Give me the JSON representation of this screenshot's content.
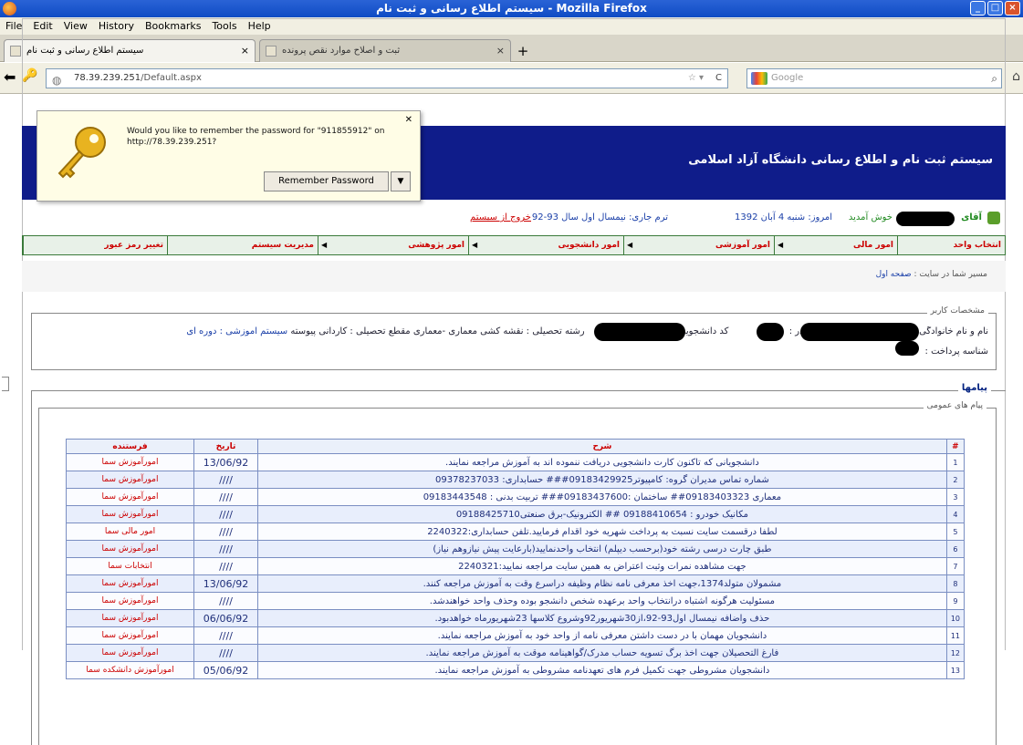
{
  "window": {
    "title": "سیستم اطلاع رسانی و ثبت نام - Mozilla Firefox"
  },
  "menu": [
    "File",
    "Edit",
    "View",
    "History",
    "Bookmarks",
    "Tools",
    "Help"
  ],
  "tabs": [
    {
      "label": "سیستم اطلاع رسانی و ثبت نام",
      "active": true
    },
    {
      "label": "ثبت و اصلاح موارد نقص پرونده",
      "active": false
    }
  ],
  "nav": {
    "url_host": "78.39.239.251",
    "url_path": "/Default.aspx",
    "search_placeholder": "Google"
  },
  "password_prompt": {
    "message": "Would you like to remember the password for \"911855912\" on http://78.39.239.251?",
    "button": "Remember Password"
  },
  "banner": {
    "title": "سیستم ثبت نام و اطلاع رسانی دانشگاه آزاد اسلامی"
  },
  "userbar": {
    "greeting": "آقای",
    "welcome": "خوش آمدید",
    "date": "امروز: شنبه 4 آبان 1392",
    "term": "ترم جاری: نیمسال اول سال 93-92",
    "exit": "خروج از سیستم",
    "portal": "پرتال"
  },
  "menu_items": [
    {
      "label": "انتخاب واحد",
      "arrow": false
    },
    {
      "label": "امور مالی",
      "arrow": true
    },
    {
      "label": "امور آموزشی",
      "arrow": true
    },
    {
      "label": "امور دانشجویی",
      "arrow": true
    },
    {
      "label": "امور پژوهشی",
      "arrow": true
    },
    {
      "label": "مدیریت سیستم",
      "arrow": false
    },
    {
      "label": "تغییر رمز عبور",
      "arrow": false
    }
  ],
  "breadcrumb": {
    "prefix": "مسیر شما در سایت :",
    "link": "صفحه اول"
  },
  "user_info": {
    "legend": "مشخصات کاربر",
    "name_label": "نام و نام خانوادگی :",
    "father_label": "پدر :",
    "id_label": "کد دانشجویی :",
    "major_label": "رشته تحصیلی :",
    "major": "نقشه کشی معماری -معماری",
    "level_label": "مقطع تحصیلی :",
    "level": "کاردانی پیوسته",
    "system_label": "سیستم آموزشی :",
    "system": "دوره ای",
    "payment_label": "شناسه پرداخت :"
  },
  "messages_legend": "پیامها",
  "public_legend": "پیام های عمومی",
  "table": {
    "headers": {
      "num": "#",
      "desc": "شرح",
      "date": "تاریخ",
      "sender": "فرستنده"
    },
    "rows": [
      {
        "num": "1",
        "desc": "دانشجویانی که تاکنون کارت دانشجویی دریافت ننموده اند به آموزش مراجعه نمایند.",
        "date": "13/06/92",
        "sender": "امورآموزش سما"
      },
      {
        "num": "2",
        "desc": "شماره تماس مدیران گروه: کامپیوتر09183429925### حسابداری: 09378237033",
        "date": "////",
        "sender": "امورآموزش سما"
      },
      {
        "num": "3",
        "desc": "معماری 09183403323## ساختمان :09183437600### تربیت بدنی : 09183443548",
        "date": "////",
        "sender": "امورآموزش سما"
      },
      {
        "num": "4",
        "desc": "مکانیک خودرو : 09188410654 ## الکترونیک-برق صنعتی09188425710",
        "date": "////",
        "sender": "امورآموزش سما"
      },
      {
        "num": "5",
        "desc": "لطفا درقسمت سایت نسبت به پرداخت شهریه خود اقدام فرمایید.تلفن حسابداری:2240322",
        "date": "////",
        "sender": "امور مالی سما"
      },
      {
        "num": "6",
        "desc": "طبق چارت درسی رشته خود(برحسب دیپلم) انتخاب واحدنمایید(بارعایت پیش نیازوهم نیاز)",
        "date": "////",
        "sender": "امورآموزش سما"
      },
      {
        "num": "7",
        "desc": "جهت مشاهده نمرات وثبت اعتراض به همین سایت مراجعه نمایید:2240321",
        "date": "////",
        "sender": "انتخابات سما"
      },
      {
        "num": "8",
        "desc": "مشمولان متولد1374،جهت اخذ معرفی نامه نظام وظیفه دراسرع وقت به آموزش مراجعه کنند.",
        "date": "13/06/92",
        "sender": "امورآموزش سما"
      },
      {
        "num": "9",
        "desc": "مسئولیت هرگونه اشتباه درانتخاب واحد برعهده شخص دانشجو بوده وحذف واحد خواهندشد.",
        "date": "////",
        "sender": "امورآموزش سما"
      },
      {
        "num": "10",
        "desc": "حذف واضافه نیمسال اول93-92،از30شهریور92وشروع کلاسها 23شهریورماه خواهدبود.",
        "date": "06/06/92",
        "sender": "امورآموزش سما"
      },
      {
        "num": "11",
        "desc": "دانشجویان مهمان با در دست داشتن معرفی نامه از واحد خود به آموزش مراجعه نمایند.",
        "date": "////",
        "sender": "امورآموزش سما"
      },
      {
        "num": "12",
        "desc": "فارغ التحصیلان جهت اخذ برگ تسویه حساب مدرک/گواهینامه موقت به آموزش مراجعه نمایند.",
        "date": "////",
        "sender": "امورآموزش سما"
      },
      {
        "num": "13",
        "desc": "دانشجویان مشروطی جهت تکمیل فرم های تعهدنامه مشروطی به آموزش مراجعه نمایند.",
        "date": "05/06/92",
        "sender": "امورآموزش دانشکده سما"
      }
    ]
  }
}
